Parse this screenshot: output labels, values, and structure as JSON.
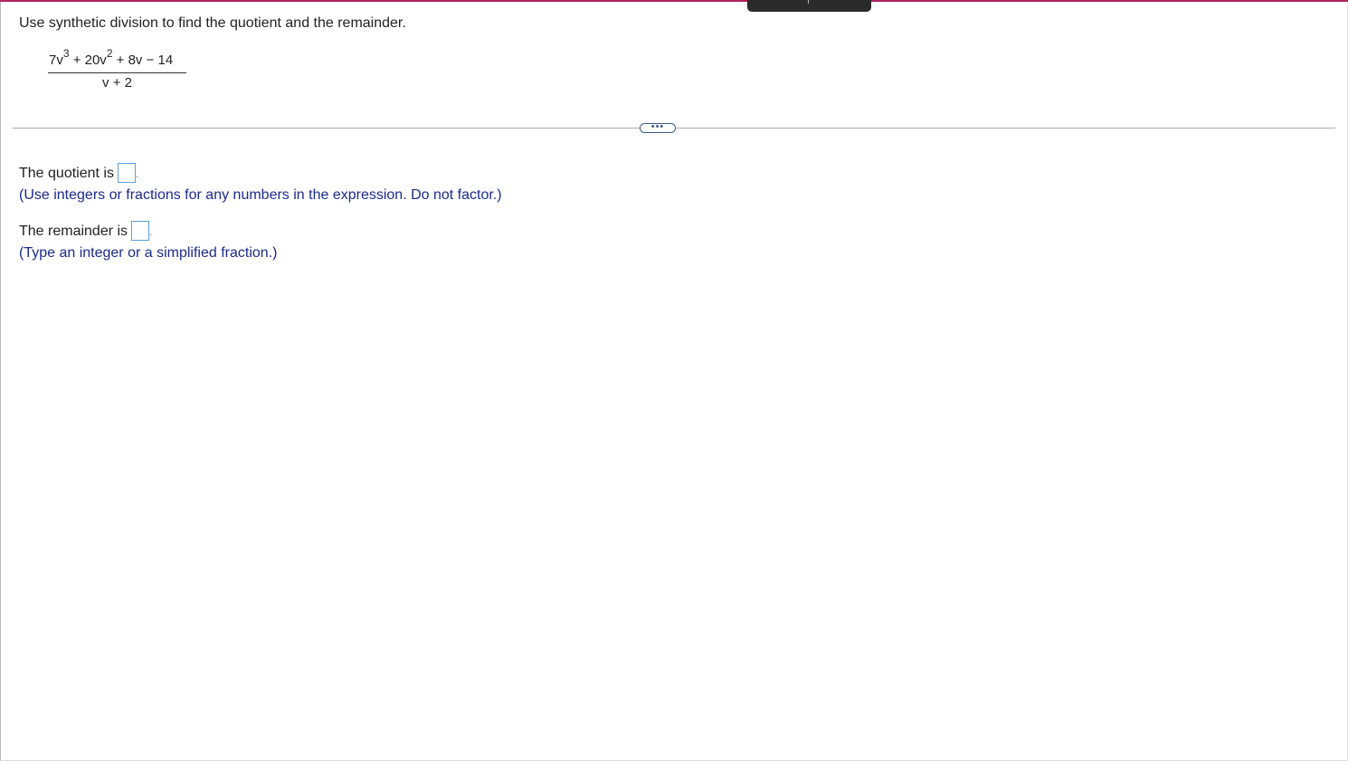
{
  "question": {
    "instruction": "Use synthetic division to find the quotient and the remainder."
  },
  "expression": {
    "numerator": {
      "t1_coef": "7v",
      "t1_exp": "3",
      "op1": " + 20v",
      "t2_exp": "2",
      "rest": " +  8v − 14"
    },
    "denominator": "v + 2"
  },
  "more_button": {
    "label": "•••"
  },
  "quotient": {
    "label": "The quotient is",
    "period": ".",
    "hint": "(Use integers or fractions for any numbers in the expression. Do not factor.)"
  },
  "remainder": {
    "label": "The remainder is",
    "period": ".",
    "hint": "(Type an integer or a simplified fraction.)"
  },
  "colors": {
    "accent": "#b3215e",
    "hint_text": "#1b2a8c",
    "input_border": "#5aa0d8"
  }
}
